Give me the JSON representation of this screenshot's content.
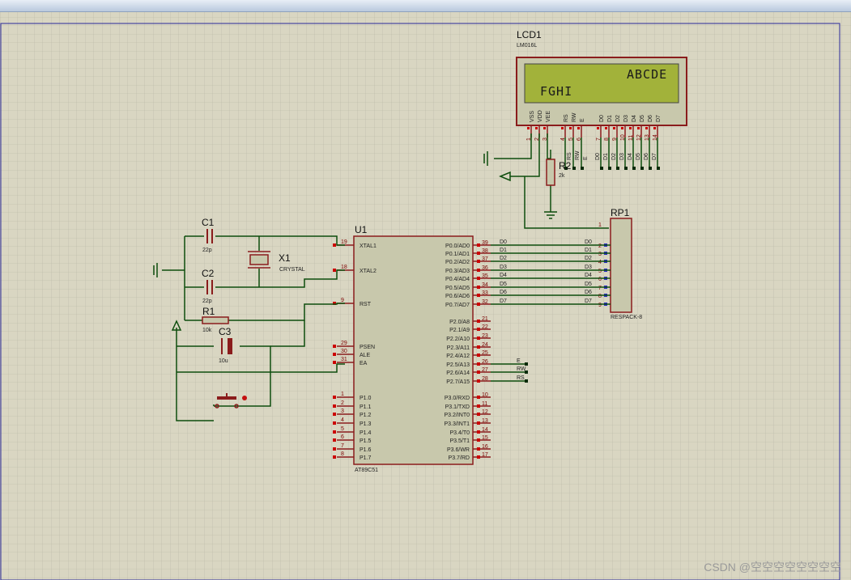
{
  "watermark": "CSDN @空空空空空空空空",
  "lcd": {
    "ref": "LCD1",
    "model": "LM016L",
    "line1": "ABCDE",
    "line2": "FGHI",
    "pins": [
      "VSS",
      "VDD",
      "VEE",
      "RS",
      "RW",
      "E",
      "D0",
      "D1",
      "D2",
      "D3",
      "D4",
      "D5",
      "D6",
      "D7"
    ],
    "pin_numbers": [
      "1",
      "2",
      "3",
      "4",
      "5",
      "6",
      "7",
      "8",
      "9",
      "10",
      "11",
      "12",
      "13",
      "14"
    ]
  },
  "r2": {
    "ref": "R2",
    "value": "2k"
  },
  "rp1": {
    "ref": "RP1",
    "model": "RESPACK-8",
    "pin1": "1",
    "pin_numbers": [
      "2",
      "3",
      "4",
      "5",
      "6",
      "7",
      "8",
      "9"
    ]
  },
  "u1": {
    "ref": "U1",
    "model": "AT89C51",
    "left_pins": [
      {
        "num": "19",
        "name": "XTAL1"
      },
      {
        "num": "18",
        "name": "XTAL2"
      },
      {
        "num": "9",
        "name": "RST"
      },
      {
        "num": "29",
        "name": "PSEN"
      },
      {
        "num": "30",
        "name": "ALE"
      },
      {
        "num": "31",
        "name": "EA"
      },
      {
        "num": "1",
        "name": "P1.0"
      },
      {
        "num": "2",
        "name": "P1.1"
      },
      {
        "num": "3",
        "name": "P1.2"
      },
      {
        "num": "4",
        "name": "P1.3"
      },
      {
        "num": "5",
        "name": "P1.4"
      },
      {
        "num": "6",
        "name": "P1.5"
      },
      {
        "num": "7",
        "name": "P1.6"
      },
      {
        "num": "8",
        "name": "P1.7"
      }
    ],
    "right_pins": [
      {
        "num": "39",
        "name": "P0.0/AD0"
      },
      {
        "num": "38",
        "name": "P0.1/AD1"
      },
      {
        "num": "37",
        "name": "P0.2/AD2"
      },
      {
        "num": "36",
        "name": "P0.3/AD3"
      },
      {
        "num": "35",
        "name": "P0.4/AD4"
      },
      {
        "num": "34",
        "name": "P0.5/AD5"
      },
      {
        "num": "33",
        "name": "P0.6/AD6"
      },
      {
        "num": "32",
        "name": "P0.7/AD7"
      },
      {
        "num": "21",
        "name": "P2.0/A8"
      },
      {
        "num": "22",
        "name": "P2.1/A9"
      },
      {
        "num": "23",
        "name": "P2.2/A10"
      },
      {
        "num": "24",
        "name": "P2.3/A11"
      },
      {
        "num": "25",
        "name": "P2.4/A12"
      },
      {
        "num": "26",
        "name": "P2.5/A13"
      },
      {
        "num": "27",
        "name": "P2.6/A14"
      },
      {
        "num": "28",
        "name": "P2.7/A15"
      },
      {
        "num": "10",
        "name": "P3.0/RXD"
      },
      {
        "num": "11",
        "name": "P3.1/TXD"
      },
      {
        "num": "12",
        "name": "P3.2/INT0"
      },
      {
        "num": "13",
        "name": "P3.3/INT1"
      },
      {
        "num": "14",
        "name": "P3.4/T0"
      },
      {
        "num": "15",
        "name": "P3.5/T1"
      },
      {
        "num": "16",
        "name": "P3.6/WR"
      },
      {
        "num": "17",
        "name": "P3.7/RD"
      }
    ]
  },
  "p0_net_labels": [
    "D0",
    "D1",
    "D2",
    "D3",
    "D4",
    "D5",
    "D6",
    "D7"
  ],
  "p2_net_labels": [
    "E",
    "RW",
    "RS"
  ],
  "c1": {
    "ref": "C1",
    "value": "22p"
  },
  "c2": {
    "ref": "C2",
    "value": "22p"
  },
  "c3": {
    "ref": "C3",
    "value": "10u"
  },
  "r1": {
    "ref": "R1",
    "value": "10k"
  },
  "x1": {
    "ref": "X1",
    "value": "CRYSTAL"
  }
}
